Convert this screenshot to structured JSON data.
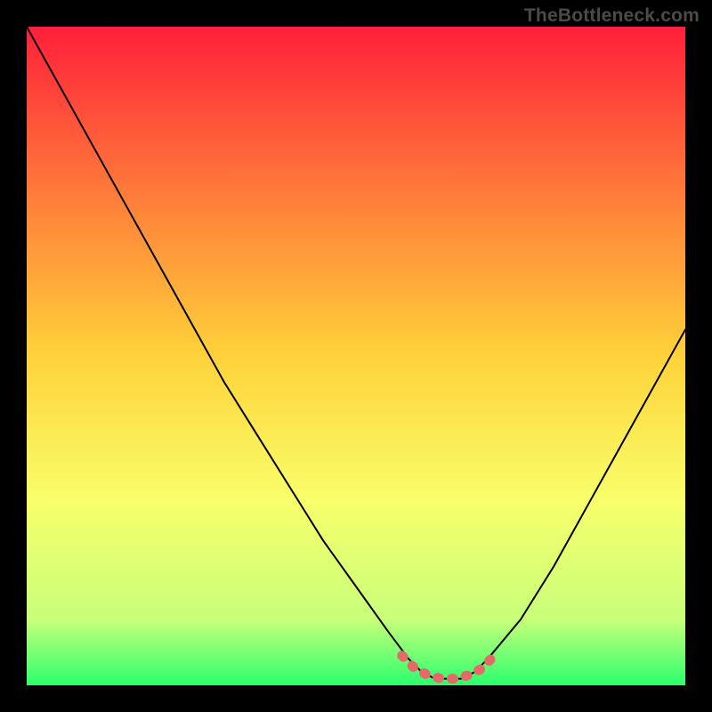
{
  "watermark": "TheBottleneck.com",
  "colors": {
    "background": "#000000",
    "gradient_top": "#ff1f3a",
    "gradient_mid_upper": "#ff7a3a",
    "gradient_mid": "#ffd23a",
    "gradient_mid_lower": "#f8ff6a",
    "gradient_lower": "#c8ff7a",
    "gradient_bottom": "#2cff6e",
    "curve": "#000000",
    "marker": "#e46a6a"
  },
  "chart_data": {
    "type": "line",
    "title": "",
    "xlabel": "",
    "ylabel": "",
    "xlim": [
      0,
      100
    ],
    "ylim": [
      0,
      100
    ],
    "grid": false,
    "annotations": [
      "TheBottleneck.com"
    ],
    "legend": [],
    "series": [
      {
        "name": "bottleneck-curve",
        "x": [
          0,
          5,
          10,
          15,
          20,
          25,
          30,
          35,
          40,
          45,
          50,
          55,
          58,
          60,
          62,
          64,
          66,
          68,
          70,
          75,
          80,
          85,
          90,
          95,
          100
        ],
        "y": [
          100,
          91,
          82,
          73,
          64,
          55,
          46,
          38,
          30,
          22,
          15,
          8,
          4,
          2,
          1,
          1,
          1,
          2,
          4,
          10,
          18,
          27,
          36,
          45,
          54
        ]
      }
    ],
    "markers": {
      "name": "optimal-zone",
      "x": [
        57,
        59,
        61,
        63,
        65,
        67,
        69,
        71
      ],
      "y": [
        4.5,
        2.5,
        1.5,
        1,
        1,
        1.5,
        2.5,
        4.5
      ]
    }
  }
}
